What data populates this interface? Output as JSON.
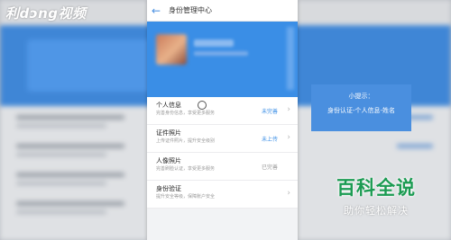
{
  "watermark": {
    "logo_text": "利dɔng视频"
  },
  "app": {
    "title": "身份管理中心",
    "back_icon": "arrow-left-icon",
    "accent": "#3a8ee6"
  },
  "list": {
    "items": [
      {
        "title": "个人信息",
        "desc": "完善身份信息，享受更多服务",
        "status": "未完善",
        "status_type": "pending"
      },
      {
        "title": "证件照片",
        "desc": "上传证件照片，提升安全级别",
        "status": "未上传",
        "status_type": "pending"
      },
      {
        "title": "人像照片",
        "desc": "完善刷脸认证，享受更多服务",
        "status": "已完善",
        "status_type": "done"
      },
      {
        "title": "身份验证",
        "desc": "提升安全等级，保障账户安全",
        "status": "",
        "status_type": "none"
      }
    ]
  },
  "tip": {
    "heading": "小提示：",
    "text": "身份认证-个人信息-姓名"
  },
  "brand": {
    "name": "百科全说",
    "slogan": "助你轻松解决"
  }
}
